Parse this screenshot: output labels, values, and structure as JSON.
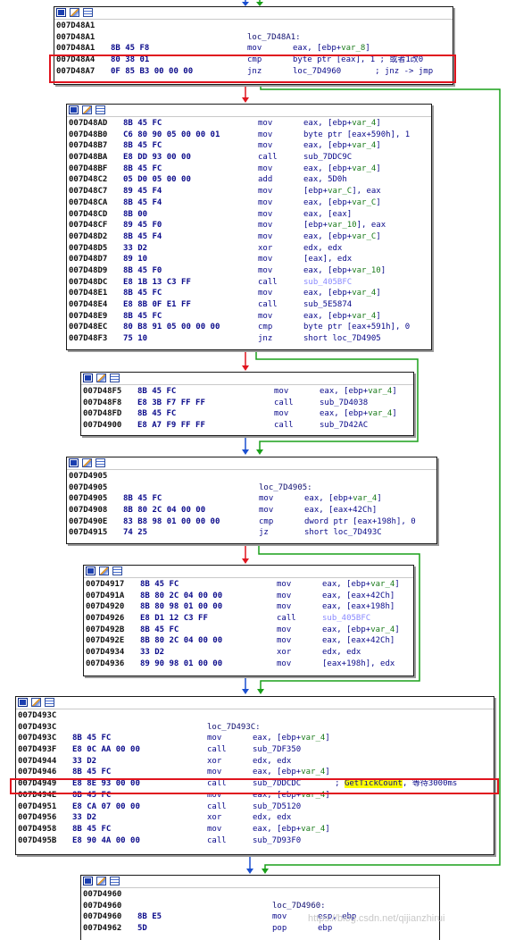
{
  "colors": {
    "true_branch": "#1aa01a",
    "false_branch": "#e0141e",
    "flow": "#1a4fd0",
    "highlight": "#ffff00",
    "annotation_box": "#e0141e"
  },
  "icons": [
    "graph-icon",
    "edit-icon",
    "listing-icon"
  ],
  "blocks": [
    {
      "id": "b1",
      "lines": [
        {
          "addr": "007D48A1"
        },
        {
          "addr": "007D48A1",
          "label": "loc_7D48A1:"
        },
        {
          "addr": "007D48A1",
          "bytes": "8B 45 F8",
          "mn": "mov",
          "op": "eax, [ebp+",
          "v": "var_8",
          "tail": "]"
        },
        {
          "addr": "007D48A4",
          "bytes": "80 38 01",
          "mn": "cmp",
          "op": "byte ptr [eax], 1 ; 或者1改0"
        },
        {
          "addr": "007D48A7",
          "bytes": "0F 85 B3 00 00 00",
          "mn": "jnz",
          "op": "loc_7D4960       ; jnz -> jmp"
        }
      ]
    },
    {
      "id": "b2",
      "lines": [
        {
          "addr": "007D48AD",
          "bytes": "8B 45 FC",
          "mn": "mov",
          "op": "eax, [ebp+",
          "v": "var_4",
          "tail": "]"
        },
        {
          "addr": "007D48B0",
          "bytes": "C6 80 90 05 00 00 01",
          "mn": "mov",
          "op": "byte ptr [eax+590h], 1"
        },
        {
          "addr": "007D48B7",
          "bytes": "8B 45 FC",
          "mn": "mov",
          "op": "eax, [ebp+",
          "v": "var_4",
          "tail": "]"
        },
        {
          "addr": "007D48BA",
          "bytes": "E8 DD 93 00 00",
          "mn": "call",
          "op": "sub_7DDC9C"
        },
        {
          "addr": "007D48BF",
          "bytes": "8B 45 FC",
          "mn": "mov",
          "op": "eax, [ebp+",
          "v": "var_4",
          "tail": "]"
        },
        {
          "addr": "007D48C2",
          "bytes": "05 D0 05 00 00",
          "mn": "add",
          "op": "eax, 5D0h"
        },
        {
          "addr": "007D48C7",
          "bytes": "89 45 F4",
          "mn": "mov",
          "op": "[ebp+",
          "v": "var_C",
          "tail": "], eax"
        },
        {
          "addr": "007D48CA",
          "bytes": "8B 45 F4",
          "mn": "mov",
          "op": "eax, [ebp+",
          "v": "var_C",
          "tail": "]"
        },
        {
          "addr": "007D48CD",
          "bytes": "8B 00",
          "mn": "mov",
          "op": "eax, [eax]"
        },
        {
          "addr": "007D48CF",
          "bytes": "89 45 F0",
          "mn": "mov",
          "op": "[ebp+",
          "v": "var_10",
          "tail": "], eax"
        },
        {
          "addr": "007D48D2",
          "bytes": "8B 45 F4",
          "mn": "mov",
          "op": "eax, [ebp+",
          "v": "var_C",
          "tail": "]"
        },
        {
          "addr": "007D48D5",
          "bytes": "33 D2",
          "mn": "xor",
          "op": "edx, edx"
        },
        {
          "addr": "007D48D7",
          "bytes": "89 10",
          "mn": "mov",
          "op": "[eax], edx"
        },
        {
          "addr": "007D48D9",
          "bytes": "8B 45 F0",
          "mn": "mov",
          "op": "eax, [ebp+",
          "v": "var_10",
          "tail": "]"
        },
        {
          "addr": "007D48DC",
          "bytes": "E8 1B 13 C3 FF",
          "mn": "call",
          "op": "",
          "g": "sub_405BFC"
        },
        {
          "addr": "007D48E1",
          "bytes": "8B 45 FC",
          "mn": "mov",
          "op": "eax, [ebp+",
          "v": "var_4",
          "tail": "]"
        },
        {
          "addr": "007D48E4",
          "bytes": "E8 8B 0F E1 FF",
          "mn": "call",
          "op": "sub_5E5874"
        },
        {
          "addr": "007D48E9",
          "bytes": "8B 45 FC",
          "mn": "mov",
          "op": "eax, [ebp+",
          "v": "var_4",
          "tail": "]"
        },
        {
          "addr": "007D48EC",
          "bytes": "80 B8 91 05 00 00 00",
          "mn": "cmp",
          "op": "byte ptr [eax+591h], 0"
        },
        {
          "addr": "007D48F3",
          "bytes": "75 10",
          "mn": "jnz",
          "op": "short loc_7D4905"
        }
      ]
    },
    {
      "id": "b3",
      "lines": [
        {
          "addr": "007D48F5",
          "bytes": "8B 45 FC",
          "mn": "mov",
          "op": "eax, [ebp+",
          "v": "var_4",
          "tail": "]"
        },
        {
          "addr": "007D48F8",
          "bytes": "E8 3B F7 FF FF",
          "mn": "call",
          "op": "sub_7D4038"
        },
        {
          "addr": "007D48FD",
          "bytes": "8B 45 FC",
          "mn": "mov",
          "op": "eax, [ebp+",
          "v": "var_4",
          "tail": "]"
        },
        {
          "addr": "007D4900",
          "bytes": "E8 A7 F9 FF FF",
          "mn": "call",
          "op": "sub_7D42AC"
        }
      ]
    },
    {
      "id": "b4",
      "lines": [
        {
          "addr": "007D4905"
        },
        {
          "addr": "007D4905",
          "label": "loc_7D4905:"
        },
        {
          "addr": "007D4905",
          "bytes": "8B 45 FC",
          "mn": "mov",
          "op": "eax, [ebp+",
          "v": "var_4",
          "tail": "]"
        },
        {
          "addr": "007D4908",
          "bytes": "8B 80 2C 04 00 00",
          "mn": "mov",
          "op": "eax, [eax+42Ch]"
        },
        {
          "addr": "007D490E",
          "bytes": "83 B8 98 01 00 00 00",
          "mn": "cmp",
          "op": "dword ptr [eax+198h], 0"
        },
        {
          "addr": "007D4915",
          "bytes": "74 25",
          "mn": "jz",
          "op": "short loc_7D493C"
        }
      ]
    },
    {
      "id": "b5",
      "lines": [
        {
          "addr": "007D4917",
          "bytes": "8B 45 FC",
          "mn": "mov",
          "op": "eax, [ebp+",
          "v": "var_4",
          "tail": "]"
        },
        {
          "addr": "007D491A",
          "bytes": "8B 80 2C 04 00 00",
          "mn": "mov",
          "op": "eax, [eax+42Ch]"
        },
        {
          "addr": "007D4920",
          "bytes": "8B 80 98 01 00 00",
          "mn": "mov",
          "op": "eax, [eax+198h]"
        },
        {
          "addr": "007D4926",
          "bytes": "E8 D1 12 C3 FF",
          "mn": "call",
          "op": "",
          "g": "sub_405BFC"
        },
        {
          "addr": "007D492B",
          "bytes": "8B 45 FC",
          "mn": "mov",
          "op": "eax, [ebp+",
          "v": "var_4",
          "tail": "]"
        },
        {
          "addr": "007D492E",
          "bytes": "8B 80 2C 04 00 00",
          "mn": "mov",
          "op": "eax, [eax+42Ch]"
        },
        {
          "addr": "007D4934",
          "bytes": "33 D2",
          "mn": "xor",
          "op": "edx, edx"
        },
        {
          "addr": "007D4936",
          "bytes": "89 90 98 01 00 00",
          "mn": "mov",
          "op": "[eax+198h], edx"
        }
      ]
    },
    {
      "id": "b6",
      "lines": [
        {
          "addr": "007D493C"
        },
        {
          "addr": "007D493C",
          "label": "loc_7D493C:"
        },
        {
          "addr": "007D493C",
          "bytes": "8B 45 FC",
          "mn": "mov",
          "op": "eax, [ebp+",
          "v": "var_4",
          "tail": "]"
        },
        {
          "addr": "007D493F",
          "bytes": "E8 0C AA 00 00",
          "mn": "call",
          "op": "sub_7DF350"
        },
        {
          "addr": "007D4944",
          "bytes": "33 D2",
          "mn": "xor",
          "op": "edx, edx"
        },
        {
          "addr": "007D4946",
          "bytes": "8B 45 FC",
          "mn": "mov",
          "op": "eax, [ebp+",
          "v": "var_4",
          "tail": "]"
        },
        {
          "addr": "007D4949",
          "bytes": "E8 8E 93 00 00",
          "mn": "call",
          "op": "sub_7DDCDC       ; ",
          "h": "GetTickCount",
          "tail2": ", 等待3000ms"
        },
        {
          "addr": "007D494E",
          "bytes": "8B 45 FC",
          "mn": "mov",
          "op": "eax, [ebp+",
          "v": "var_4",
          "tail": "]"
        },
        {
          "addr": "007D4951",
          "bytes": "E8 CA 07 00 00",
          "mn": "call",
          "op": "sub_7D5120"
        },
        {
          "addr": "007D4956",
          "bytes": "33 D2",
          "mn": "xor",
          "op": "edx, edx"
        },
        {
          "addr": "007D4958",
          "bytes": "8B 45 FC",
          "mn": "mov",
          "op": "eax, [ebp+",
          "v": "var_4",
          "tail": "]"
        },
        {
          "addr": "007D495B",
          "bytes": "E8 90 4A 00 00",
          "mn": "call",
          "op": "sub_7D93F0"
        }
      ]
    },
    {
      "id": "b7",
      "lines": [
        {
          "addr": "007D4960"
        },
        {
          "addr": "007D4960",
          "label": "loc_7D4960:"
        },
        {
          "addr": "007D4960",
          "bytes": "8B E5",
          "mn": "mov",
          "op": "esp, ebp"
        },
        {
          "addr": "007D4962",
          "bytes": "5D",
          "mn": "pop",
          "op": "ebp"
        }
      ]
    }
  ],
  "watermark": "https://blog.csdn.net/qijianzhirui"
}
